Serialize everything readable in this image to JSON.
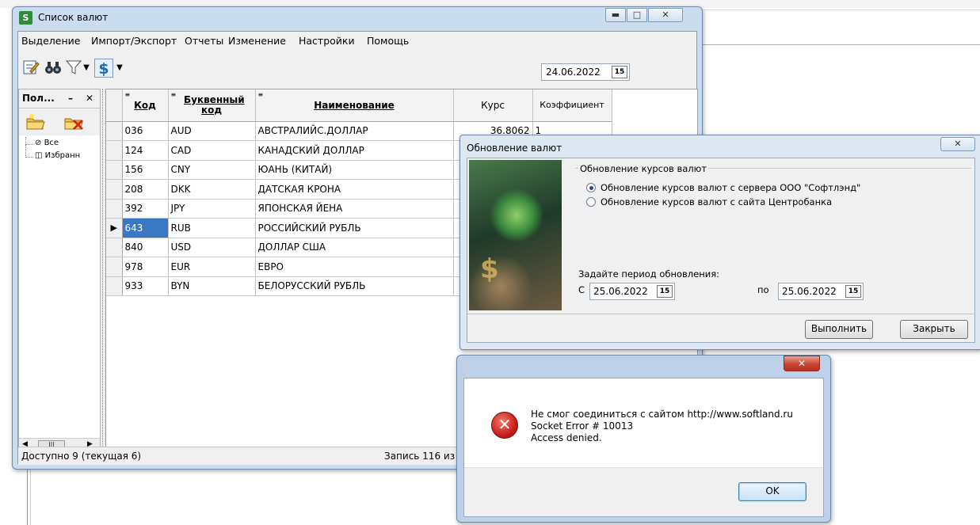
{
  "main_window": {
    "title": "Список валют",
    "menu": [
      "Выделение",
      "Импорт/Экспорт",
      "Отчеты",
      "Изменение",
      "Настройки",
      "Помощь"
    ],
    "date": "24.06.2022",
    "left_panel": {
      "title": "Пол...",
      "tree": [
        "Все",
        "Избранн"
      ]
    },
    "table": {
      "columns": [
        "Код",
        "Буквенный код",
        "Наименование",
        "Курс",
        "Коэффициент"
      ],
      "rows": [
        [
          "036",
          "AUD",
          "АВСТРАЛИЙС.ДОЛЛАР",
          "36.8062",
          "1"
        ],
        [
          "124",
          "CAD",
          "КАНАДСКИЙ ДОЛЛАР",
          "",
          ""
        ],
        [
          "156",
          "CNY",
          "ЮАНЬ (КИТАЙ)",
          "",
          ""
        ],
        [
          "208",
          "DKK",
          "ДАТСКАЯ КРОНА",
          "",
          ""
        ],
        [
          "392",
          "JPY",
          "ЯПОНСКАЯ ЙЕНА",
          "",
          ""
        ],
        [
          "643",
          "RUB",
          "РОССИЙСКИЙ РУБЛЬ",
          "",
          ""
        ],
        [
          "840",
          "USD",
          "ДОЛЛАР США",
          "",
          ""
        ],
        [
          "978",
          "EUR",
          "ЕВРО",
          "",
          ""
        ],
        [
          "933",
          "BYN",
          "БЕЛОРУССКИЙ РУБЛЬ",
          "",
          ""
        ]
      ],
      "selected_row_index": 5
    },
    "status": {
      "left": "Доступно 9 (текущая 6)",
      "right": "Запись 116 из 1"
    }
  },
  "update_dialog": {
    "title": "Обновление валют",
    "group_label": "Обновление курсов валют",
    "options": [
      "Обновление курсов валют с сервера ООО \"Софтлэнд\"",
      "Обновление курсов валют с сайта Центробанка"
    ],
    "selected_option": 0,
    "period_label": "Задайте период обновления:",
    "from_label": "С",
    "from_date": "25.06.2022",
    "to_label": "по",
    "to_date": "25.06.2022",
    "execute_button": "Выполнить",
    "close_button": "Закрыть"
  },
  "error_dialog": {
    "lines": [
      "Не смог соединиться с сайтом http://www.softland.ru",
      "Socket Error # 10013",
      "Access denied."
    ],
    "ok_button": "OK"
  },
  "colors": {
    "selection": "#3a78c4",
    "close_red": "#c8432e",
    "window_frame": "#c9dcf0"
  }
}
